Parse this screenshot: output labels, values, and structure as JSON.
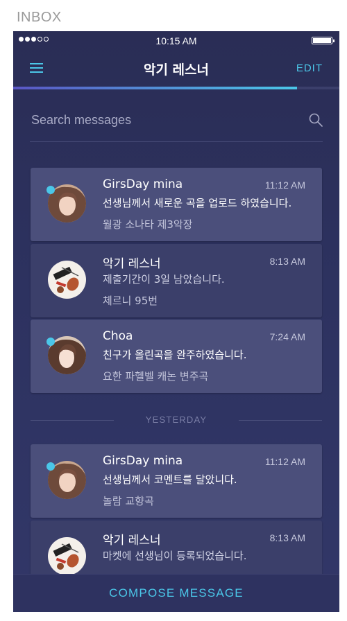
{
  "frame_label": "INBOX",
  "status_bar": {
    "time": "10:15 AM"
  },
  "nav": {
    "title": "악기 레스너",
    "edit_label": "EDIT",
    "progress": 0.87
  },
  "search": {
    "placeholder": "Search messages"
  },
  "divider": {
    "label": "YESTERDAY"
  },
  "messages": [
    {
      "sender": "GirsDay mina",
      "time": "11:12 AM",
      "preview": "선생님께서 새로운 곡을 업로드 하였습니다.",
      "subject": "월광 소나타 제3악장",
      "unread": true,
      "avatar": "girl-portrait"
    },
    {
      "sender": "악기 레스너",
      "time": "8:13 AM",
      "preview": "제출기간이 3일 남았습니다.",
      "subject": "체르니 95번",
      "unread": false,
      "avatar": "instruments"
    },
    {
      "sender": "Choa",
      "time": "7:24 AM",
      "preview": "친구가 올린곡을 완주하였습니다.",
      "subject": "요한 파헬벨 캐논 변주곡",
      "unread": true,
      "avatar": "girl-portrait"
    },
    {
      "sender": "GirsDay mina",
      "time": "11:12 AM",
      "preview": "선생님께서 코멘트를  달았니다.",
      "subject": "놀람 교향곡",
      "unread": true,
      "avatar": "girl-portrait"
    },
    {
      "sender": "악기 레스너",
      "time": "8:13 AM",
      "preview": "마켓에 선생님이 등록되었습니다.",
      "subject": "",
      "unread": false,
      "avatar": "instruments"
    }
  ],
  "compose": {
    "label": "COMPOSE MESSAGE"
  },
  "colors": {
    "accent": "#4bc7e8",
    "background": "#2d3260",
    "card_unread": "#4b4f7b",
    "card_read": "#3b3f6a"
  }
}
